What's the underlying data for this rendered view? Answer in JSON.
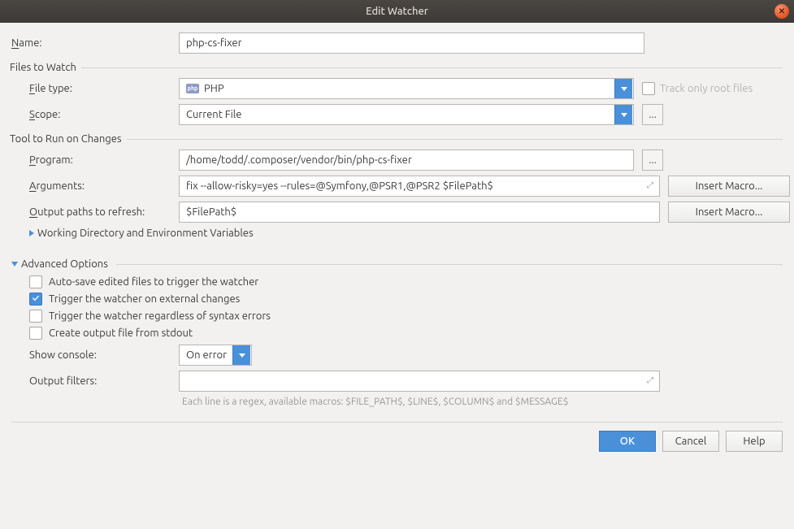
{
  "title": "Edit Watcher",
  "labels": {
    "name": "ame:",
    "name_u": "N",
    "files_to_watch": "Files to Watch",
    "file_type": "ile type:",
    "file_type_u": "F",
    "scope": "cope:",
    "scope_u": "S",
    "track_only_root": "Track only root files",
    "tool_to_run": "Tool to Run on Changes",
    "program": "rogram:",
    "program_u": "P",
    "arguments": "rguments:",
    "arguments_u": "A",
    "output_paths": "utput paths to refresh:",
    "output_paths_u": "O",
    "working_dir": "Working Directory and Environment Variables",
    "advanced_options": "Advanced Options",
    "auto_save": "Auto-save edited files to trigger the watcher",
    "trigger_external": "Trigger the watcher on external changes",
    "trigger_syntax": "Trigger the watcher regardless of syntax errors",
    "create_output": "Create output file from stdout",
    "show_console": "Show console:",
    "output_filters": "Output filters:",
    "hint": "Each line is a regex, available macros: $FILE_PATH$, $LINE$, $COLUMN$ and $MESSAGE$"
  },
  "values": {
    "name": "php-cs-fixer",
    "file_type": "PHP",
    "scope": "Current File",
    "program": "/home/todd/.composer/vendor/bin/php-cs-fixer",
    "arguments": "fix --allow-risky=yes --rules=@Symfony,@PSR1,@PSR2 $FilePath$",
    "output_paths": "$FilePath$",
    "show_console": "On error",
    "output_filters": ""
  },
  "checkboxes": {
    "track_only_root": false,
    "auto_save": false,
    "trigger_external": true,
    "trigger_syntax": false,
    "create_output": false
  },
  "buttons": {
    "insert_macro": "Insert Macro...",
    "ok": "OK",
    "cancel": "Cancel",
    "help": "Help",
    "browse": "..."
  }
}
